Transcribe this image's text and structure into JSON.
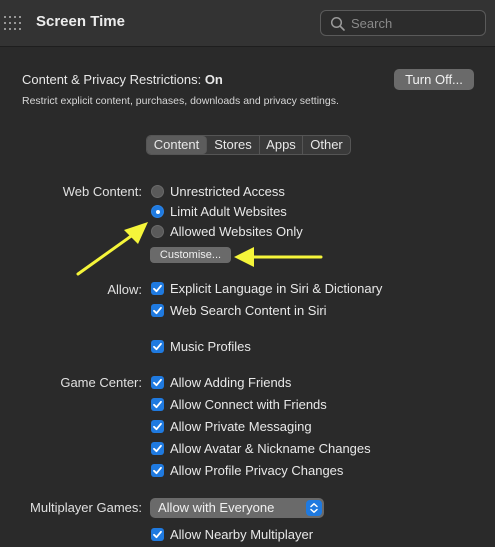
{
  "toolbar": {
    "title": "Screen Time",
    "search_placeholder": "Search"
  },
  "header": {
    "title_prefix": "Content & Privacy Restrictions:",
    "title_status": "On",
    "description": "Restrict explicit content, purchases, downloads and privacy settings.",
    "turn_off_label": "Turn Off..."
  },
  "tabs": [
    {
      "label": "Content",
      "active": true
    },
    {
      "label": "Stores",
      "active": false
    },
    {
      "label": "Apps",
      "active": false
    },
    {
      "label": "Other",
      "active": false
    }
  ],
  "web_content": {
    "label": "Web Content:",
    "options": [
      {
        "label": "Unrestricted Access",
        "selected": false
      },
      {
        "label": "Limit Adult Websites",
        "selected": true
      },
      {
        "label": "Allowed Websites Only",
        "selected": false
      }
    ],
    "customise_label": "Customise..."
  },
  "allow": {
    "label": "Allow:",
    "items": [
      {
        "label": "Explicit Language in Siri & Dictionary",
        "checked": true
      },
      {
        "label": "Web Search Content in Siri",
        "checked": true
      },
      {
        "label": "Music Profiles",
        "checked": true
      }
    ]
  },
  "game_center": {
    "label": "Game Center:",
    "items": [
      {
        "label": "Allow Adding Friends",
        "checked": true
      },
      {
        "label": "Allow Connect with Friends",
        "checked": true
      },
      {
        "label": "Allow Private Messaging",
        "checked": true
      },
      {
        "label": "Allow Avatar & Nickname Changes",
        "checked": true
      },
      {
        "label": "Allow Profile Privacy Changes",
        "checked": true
      }
    ]
  },
  "multiplayer": {
    "label": "Multiplayer Games:",
    "selected_value": "Allow with Everyone",
    "nearby_label": "Allow Nearby Multiplayer",
    "nearby_checked": true
  },
  "colors": {
    "accent": "#1f7ae0",
    "annotation_arrow": "#f5f53a",
    "background": "#2a2a2a"
  }
}
